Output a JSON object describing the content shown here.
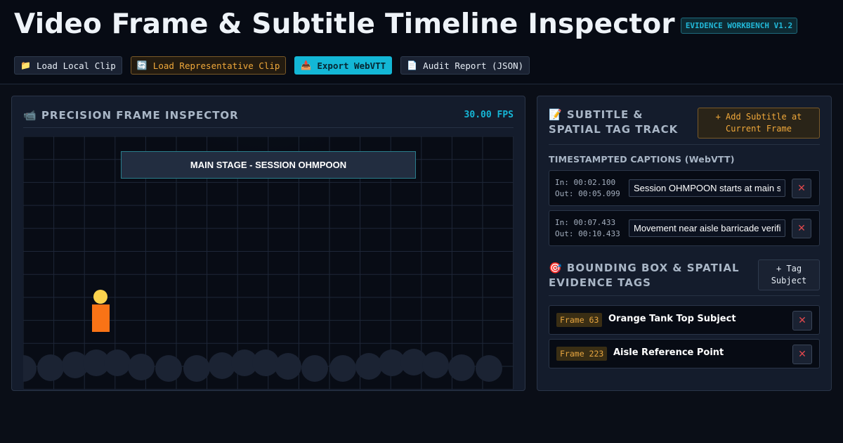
{
  "header": {
    "title": "Video Frame & Subtitle Timeline Inspector",
    "version_badge": "EVIDENCE WORKBENCH V1.2"
  },
  "toolbar": {
    "buttons": [
      {
        "icon": "📁",
        "icon_name": "folder-icon",
        "label": "Load Local Clip"
      },
      {
        "icon": "🔄",
        "icon_name": "refresh-icon",
        "label": "Load Representative Clip"
      },
      {
        "icon": "📥",
        "icon_name": "download-icon",
        "label": "Export WebVTT"
      },
      {
        "icon": "📄",
        "icon_name": "document-icon",
        "label": "Audit Report (JSON)"
      }
    ]
  },
  "inspector": {
    "icon": "📹",
    "icon_name": "video-camera-icon",
    "title": "PRECISION FRAME INSPECTOR",
    "fps": "30.00 FPS",
    "stage_banner": "MAIN STAGE - SESSION OHMPOON",
    "colors": {
      "subject_body": "#f97316",
      "subject_head": "#fcd34d",
      "spotlight": "#0e7490"
    }
  },
  "subtitles": {
    "icon": "📝",
    "icon_name": "memo-icon",
    "title": "SUBTITLE & SPATIAL TAG TRACK",
    "add_button": "+ Add Subtitle at Current Frame",
    "captions_title": "TIMESTAMPTED CAPTIONS (WebVTT)",
    "captions": [
      {
        "in": "In: 00:02.100",
        "out": "Out: 00:05.099",
        "text": "Session OHMPOON starts at main stage"
      },
      {
        "in": "In: 00:07.433",
        "out": "Out: 00:10.433",
        "text": "Movement near aisle barricade verified"
      }
    ],
    "delete_label": "✕"
  },
  "tags": {
    "icon": "🎯",
    "icon_name": "target-icon",
    "title": "BOUNDING BOX & SPATIAL EVIDENCE TAGS",
    "tag_button": "+ Tag Subject",
    "items": [
      {
        "frame": "Frame 63",
        "name": "Orange Tank Top Subject"
      },
      {
        "frame": "Frame 223",
        "name": "Aisle Reference Point"
      }
    ],
    "delete_label": "✕"
  }
}
